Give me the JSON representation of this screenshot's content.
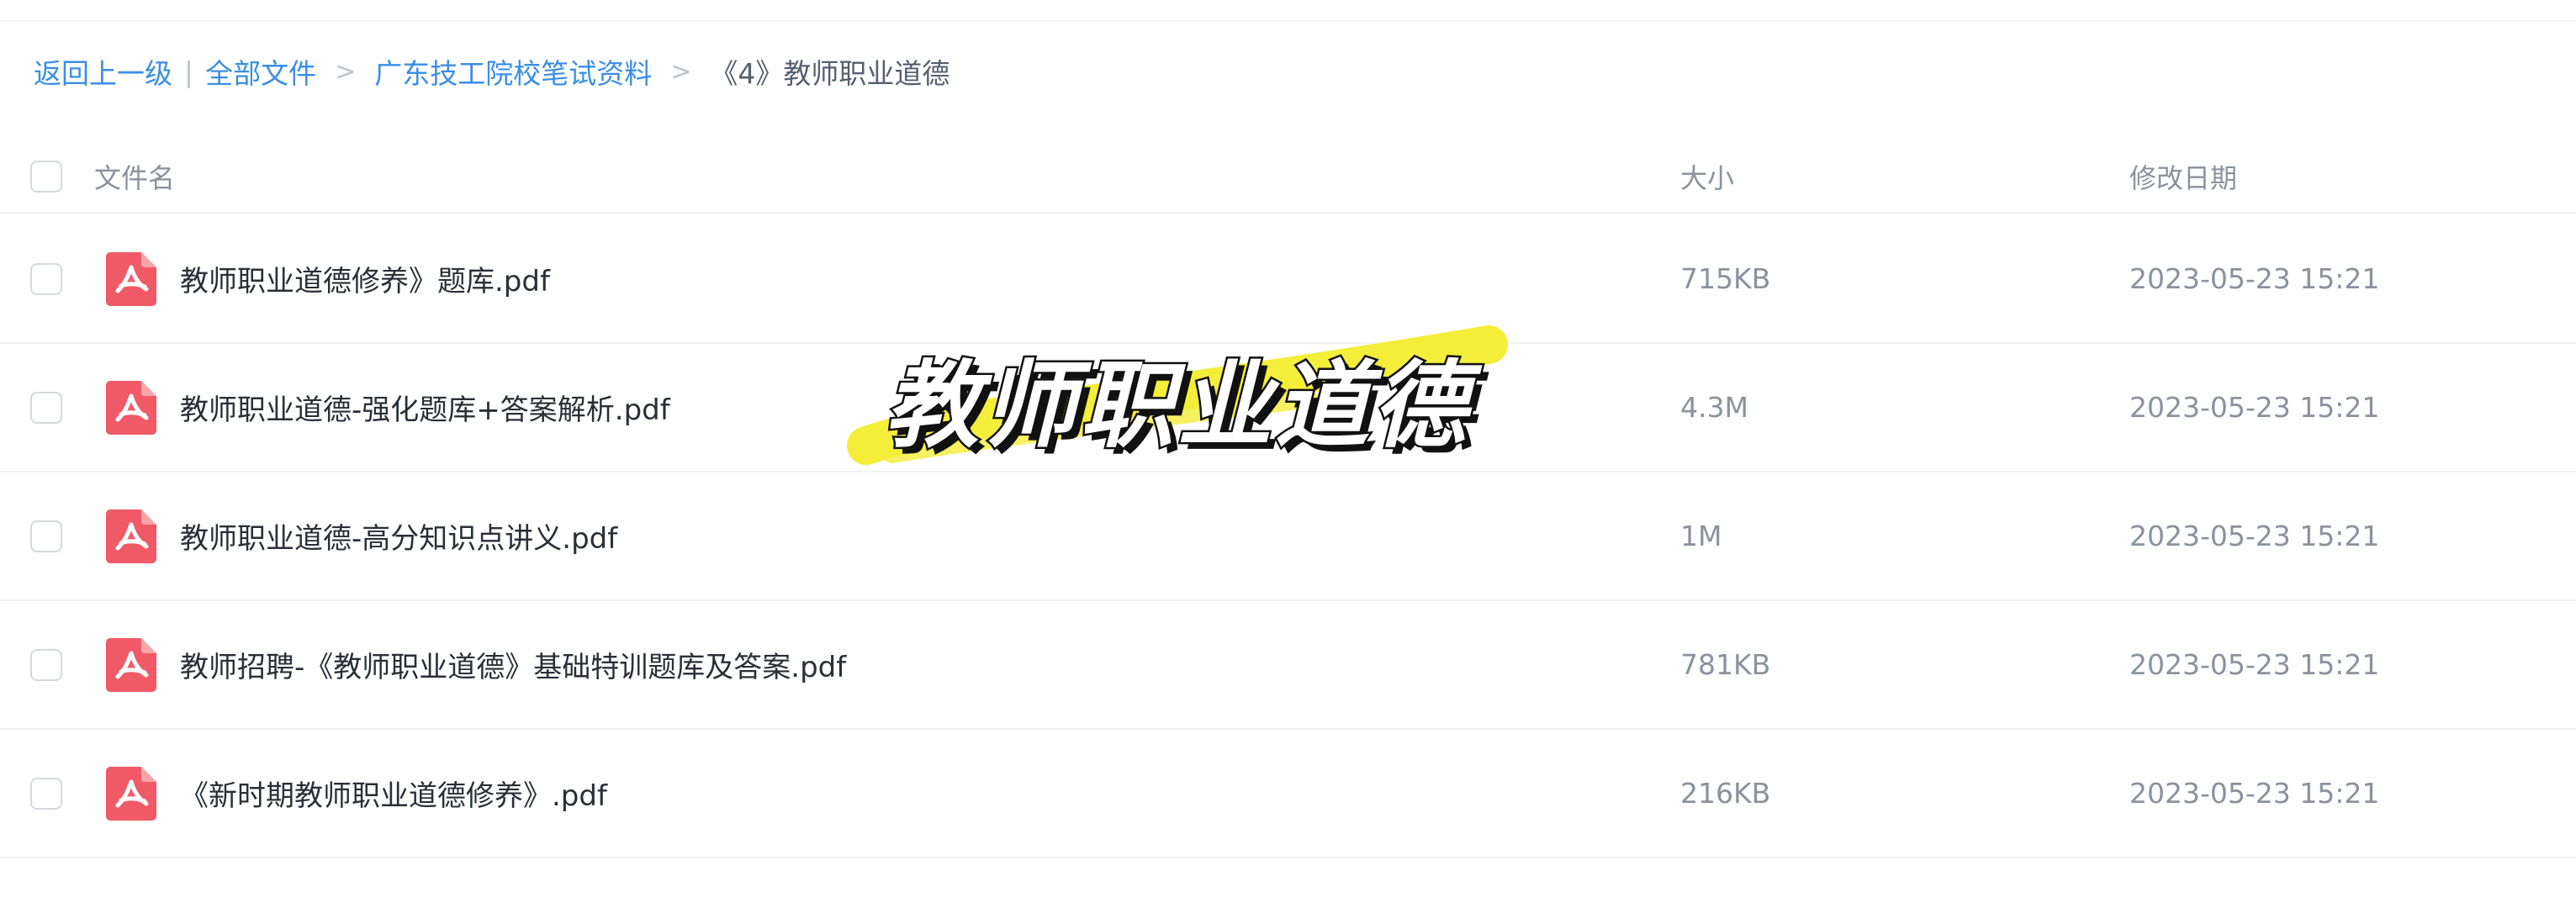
{
  "breadcrumb": {
    "back": "返回上一级",
    "pipe": "|",
    "all_files": "全部文件",
    "sep": ">",
    "folder": "广东技工院校笔试资料",
    "current": "《4》教师职业道德"
  },
  "table": {
    "columns": {
      "name": "文件名",
      "size": "大小",
      "modified": "修改日期"
    },
    "rows": [
      {
        "name": "教师职业道德修养》题库.pdf",
        "size": "715KB",
        "modified": "2023-05-23 15:21",
        "icon": "pdf-icon"
      },
      {
        "name": "教师职业道德-强化题库+答案解析.pdf",
        "size": "4.3M",
        "modified": "2023-05-23 15:21",
        "icon": "pdf-icon"
      },
      {
        "name": "教师职业道德-高分知识点讲义.pdf",
        "size": "1M",
        "modified": "2023-05-23 15:21",
        "icon": "pdf-icon"
      },
      {
        "name": "教师招聘-《教师职业道德》基础特训题库及答案.pdf",
        "size": "781KB",
        "modified": "2023-05-23 15:21",
        "icon": "pdf-icon"
      },
      {
        "name": "《新时期教师职业道德修养》.pdf",
        "size": "216KB",
        "modified": "2023-05-23 15:21",
        "icon": "pdf-icon"
      }
    ]
  },
  "overlay": {
    "title": "教师职业道德",
    "highlight_color": "#f4ee3a"
  },
  "colors": {
    "link": "#3a8ee6",
    "pdf_red": "#f05a66",
    "muted": "#8a929c",
    "text": "#2a2f36"
  }
}
